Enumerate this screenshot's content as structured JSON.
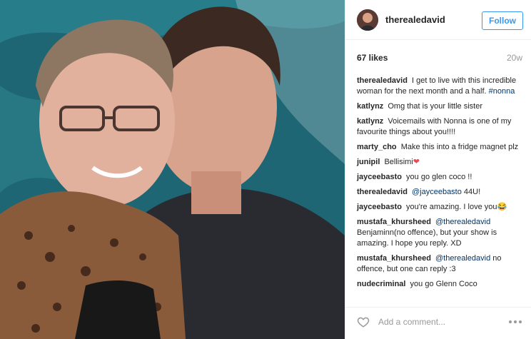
{
  "post": {
    "username": "therealedavid",
    "follow_label": "Follow",
    "likes": "67 likes",
    "age": "20w",
    "comments": [
      {
        "user": "therealedavid",
        "text": "I get to live with this incredible woman for the next month and a half.",
        "tag": "#nonna"
      },
      {
        "user": "katlynz",
        "text": "Omg that is your little sister"
      },
      {
        "user": "katlynz",
        "text": "Voicemails with Nonna is one of my favourite things about you!!!!"
      },
      {
        "user": "marty_cho",
        "text": "Make this into a fridge magnet plz"
      },
      {
        "user": "junipil",
        "text": "Bellisimi",
        "emoji": "❤"
      },
      {
        "user": "jayceebasto",
        "text": "you go glen coco !!"
      },
      {
        "user": "therealedavid",
        "mention": "@jayceebasto",
        "text": "44U!"
      },
      {
        "user": "jayceebasto",
        "text": "you're amazing. I love you",
        "emoji": "😂"
      },
      {
        "user": "mustafa_khursheed",
        "mention": "@therealedavid",
        "text": "Benjaminn(no offence), but your show is amazing. I hope you reply. XD"
      },
      {
        "user": "mustafa_khursheed",
        "mention": "@therealedavid",
        "text": "no offence, but one can reply :3"
      },
      {
        "user": "nudecriminal",
        "text": "you go Glenn Coco"
      }
    ],
    "comment_placeholder": "Add a comment..."
  },
  "icons": {
    "like": "heart-outline-icon",
    "more": "more-options-icon"
  },
  "colors": {
    "accent": "#3897f0",
    "mention": "#003569",
    "muted": "#999999"
  }
}
